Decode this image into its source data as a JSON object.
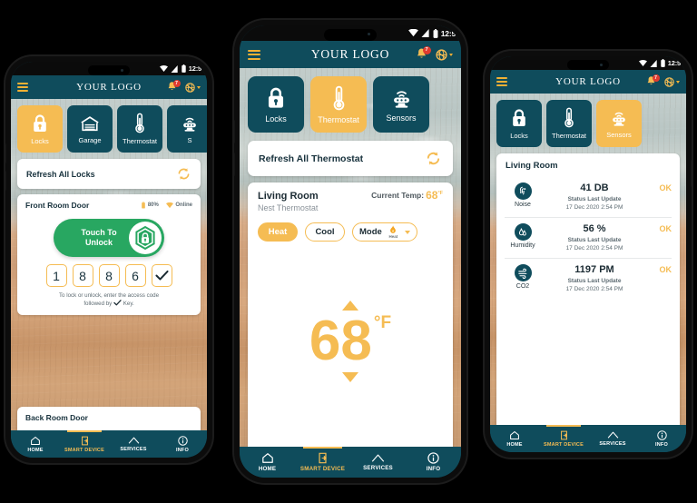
{
  "canvas": {
    "background": "#000000"
  },
  "theme": {
    "teal": "#0f4c5c",
    "amber": "#f5bc53",
    "green": "#28a761",
    "red_badge": "#e03b2f",
    "card_white": "#ffffff",
    "text_dark": "#18323d",
    "text_muted": "#5d6b72"
  },
  "statusbar": {
    "time": "12:5",
    "icons": [
      "wifi-icon",
      "signal-icon",
      "battery-icon"
    ]
  },
  "appbar": {
    "menu_icon": "hamburger-menu-icon",
    "logo": "YOUR LOGO",
    "notification_icon": "bell-icon",
    "notification_count": "7",
    "language_icon": "globe-icon",
    "language_caret": "chevron-down-icon"
  },
  "phones": [
    {
      "id": "locks-phone",
      "tabs": [
        {
          "label": "Locks",
          "icon": "padlock-icon",
          "active": true
        },
        {
          "label": "Garage",
          "icon": "garage-door-icon",
          "active": false
        },
        {
          "label": "Thermostat",
          "icon": "thermometer-icon",
          "active": false
        },
        {
          "label": "S",
          "icon": "sensor-icon",
          "active": false
        }
      ],
      "refresh": {
        "label": "Refresh All Locks",
        "icon": "refresh-icon"
      },
      "lock_card": {
        "title": "Front Room Door",
        "battery_icon": "battery-icon",
        "battery": "80%",
        "wifi_icon": "wifi-icon",
        "status": "Online",
        "unlock_label_line1": "Touch To",
        "unlock_label_line2": "Unlock",
        "unlock_knob_icon": "shield-lock-icon",
        "keys": [
          "1",
          "8",
          "8",
          "6"
        ],
        "confirm_icon": "checkmark-icon",
        "hint_line1": "To lock or unlock, enter the access code",
        "hint_line2_pre": "followed by",
        "hint_line2_post": "Key."
      },
      "second_card": {
        "title": "Back Room Door"
      }
    },
    {
      "id": "thermostat-phone",
      "tabs": [
        {
          "label": "Locks",
          "icon": "padlock-icon",
          "active": false
        },
        {
          "label": "Thermostat",
          "icon": "thermometer-icon",
          "active": true
        },
        {
          "label": "Sensors",
          "icon": "sensor-icon",
          "active": false
        }
      ],
      "refresh": {
        "label": "Refresh All Thermostat",
        "icon": "refresh-icon"
      },
      "thermostat": {
        "room": "Living Room",
        "device": "Nest Thermostat",
        "current_temp_label": "Current Temp:",
        "current_temp_value": "68",
        "current_temp_unit": "°F",
        "heat_label": "Heat",
        "cool_label": "Cool",
        "mode_label": "Mode",
        "mode_icon": "flame-icon",
        "mode_value": "Heat",
        "mode_caret": "chevron-down-icon",
        "up_icon": "triangle-up-icon",
        "down_icon": "triangle-down-icon",
        "target_temp": "68",
        "target_unit": "°F"
      }
    },
    {
      "id": "sensors-phone",
      "tabs": [
        {
          "label": "Locks",
          "icon": "padlock-icon",
          "active": false
        },
        {
          "label": "Thermostat",
          "icon": "thermometer-icon",
          "active": false
        },
        {
          "label": "Sensors",
          "icon": "sensor-icon",
          "active": true
        }
      ],
      "sensors": {
        "title": "Living Room",
        "rows": [
          {
            "name": "Noise",
            "icon": "noise-icon",
            "value": "41 DB",
            "update_label": "Status Last Update",
            "timestamp": "17 Dec 2020  2:54 PM",
            "status": "OK"
          },
          {
            "name": "Humidity",
            "icon": "humidity-icon",
            "value": "56 %",
            "update_label": "Status Last Update",
            "timestamp": "17 Dec 2020  2:54 PM",
            "status": "OK"
          },
          {
            "name": "CO2",
            "icon": "co2-wind-icon",
            "value": "1197 PM",
            "update_label": "Status Last Update",
            "timestamp": "17 Dec 2020  2:54 PM",
            "status": "OK"
          }
        ]
      }
    }
  ],
  "bottomnav": {
    "items": [
      {
        "label": "HOME",
        "icon": "home-icon",
        "active": false
      },
      {
        "label": "SMART DEVICE",
        "icon": "smart-device-icon",
        "active": true
      },
      {
        "label": "SERVICES",
        "icon": "services-icon",
        "active": false
      },
      {
        "label": "INFO",
        "icon": "info-icon",
        "active": false
      }
    ]
  }
}
